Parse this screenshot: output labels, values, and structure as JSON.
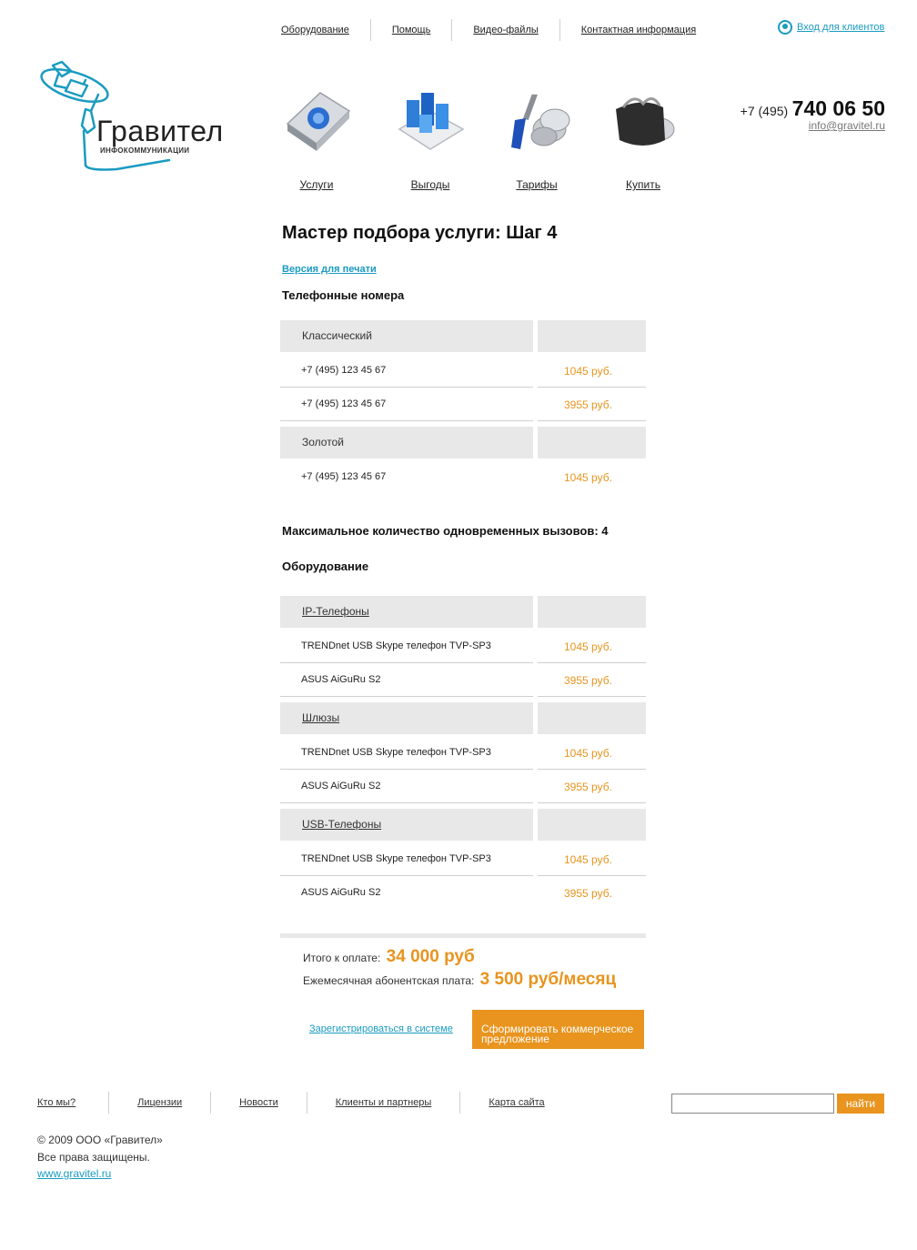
{
  "topnav": {
    "items": [
      "Оборудование",
      "Помощь",
      "Видео-файлы",
      "Контактная информация"
    ]
  },
  "login": {
    "label": "Вход для клиентов"
  },
  "logo": {
    "brand": "Гравител",
    "sub": "ИНФОКОММУНИКАЦИИ"
  },
  "icons": [
    {
      "label": "Услуги",
      "icon": "book-icon"
    },
    {
      "label": "Выгоды",
      "icon": "bar-chart-icon"
    },
    {
      "label": "Тарифы",
      "icon": "tools-coins-icon"
    },
    {
      "label": "Купить",
      "icon": "wallet-icon"
    }
  ],
  "contact": {
    "prefix": "+7 (495)",
    "number": "740 06 50",
    "email": "info@gravitel.ru"
  },
  "main": {
    "title": "Мастер подбора услуги: Шаг 4",
    "print_label": "Версия для печати",
    "phones_title": "Телефонные номера",
    "phones": [
      {
        "group": "Классический",
        "rows": [
          {
            "name": "+7 (495) 123 45 67",
            "price": "1045 руб."
          },
          {
            "name": "+7 (495) 123 45 67",
            "price": "3955 руб."
          }
        ]
      },
      {
        "group": "Золотой",
        "rows": [
          {
            "name": "+7 (495) 123 45 67",
            "price": "1045 руб."
          }
        ]
      }
    ],
    "max_calls": "Максимальное количество одновременных вызовов: 4",
    "equipment_title": "Оборудование",
    "equipment": [
      {
        "group": "IP-Телефоны",
        "rows": [
          {
            "name": "TRENDnet USB Skype телефон TVP-SP3",
            "price": "1045 руб."
          },
          {
            "name": "ASUS AiGuRu S2",
            "price": "3955 руб."
          }
        ]
      },
      {
        "group": "Шлюзы",
        "rows": [
          {
            "name": "TRENDnet USB Skype телефон TVP-SP3",
            "price": "1045 руб."
          },
          {
            "name": "ASUS AiGuRu S2",
            "price": "3955 руб."
          }
        ]
      },
      {
        "group": "USB-Телефоны",
        "rows": [
          {
            "name": "TRENDnet USB Skype телефон TVP-SP3",
            "price": "1045 руб."
          },
          {
            "name": "ASUS AiGuRu S2",
            "price": "3955 руб."
          }
        ]
      }
    ],
    "total_label": "Итого к оплате:",
    "total_value": "34 000 руб",
    "monthly_label": "Ежемесячная абонентская плата:",
    "monthly_value": "3 500 руб/месяц",
    "register_label": "Зарегистрироваться в системе",
    "offer_button": "Сформировать коммерческое предложение"
  },
  "footer": {
    "nav": [
      "Кто мы?",
      "Лицензии",
      "Новости",
      "Клиенты и партнеры",
      "Карта сайта"
    ],
    "search_button": "найти",
    "copyright": "© 2009 ООО «Гравител»",
    "rights": "Все права защищены.",
    "site": "www.gravitel.ru"
  },
  "colors": {
    "accent": "#e8941e",
    "link": "#1a9bc0",
    "row_bg": "#e8e8e8"
  }
}
